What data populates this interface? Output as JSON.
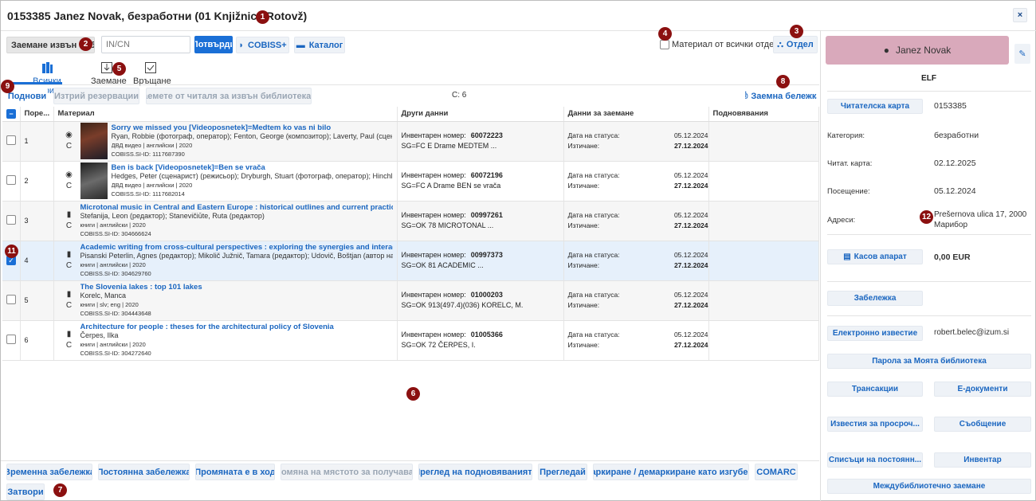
{
  "header": {
    "title": "0153385 Janez Novak, безработни (01 Knjižnica Rotovž)",
    "close": "×"
  },
  "badges": [
    "1",
    "2",
    "3",
    "4",
    "5",
    "6",
    "7",
    "8",
    "9",
    "11",
    "12"
  ],
  "toolbar": {
    "loan_outside": "Заемане извън биб",
    "input_placeholder": "IN/CN",
    "confirm": "Потвърди",
    "cobiss": "COBISS+",
    "catalog": "Каталог",
    "all_depts": "Материал от всички отдели",
    "dept": "Отдел"
  },
  "tabs": [
    {
      "label": "Всички материали"
    },
    {
      "label": "Заемане"
    },
    {
      "label": "Връщане"
    }
  ],
  "actions": {
    "renew": "Поднови",
    "delete_res": "Изтрий резервации",
    "loan_reading": "Заемете от читаля за извън библиотеката",
    "count": "С: 6",
    "loan_note": "Заемна бележка"
  },
  "table": {
    "headers": [
      "Поре...",
      "Материал",
      "Други данни",
      "Данни за заемане",
      "Подновявания"
    ],
    "rows": [
      {
        "no": "1",
        "icon": "video",
        "type": "C",
        "title": "Sorry we missed you [Videoposnetek]=Medtem ko vas ni bilo",
        "authors": "Ryan, Robbie (фотограф, оператор); Fenton, George (композитор); Laverty, Paul (сценарис",
        "pub": "ДВД видео | английски | 2020",
        "id": "COBISS.SI-ID: 1117687390",
        "inv_label": "Инвентарен номер:",
        "inv": "60072223",
        "sg": "SG=FC E Drame MEDTEM ...",
        "status_label": "Дата на статуса:",
        "status": "05.12.2024",
        "exp_label": "Изтичане:",
        "exp": "27.12.2024",
        "checked": false
      },
      {
        "no": "2",
        "icon": "video",
        "type": "C",
        "title": "Ben is back [Videoposnetek]=Ben se vrača",
        "authors": "Hedges, Peter (сценарист) (режисьор); Dryburgh, Stuart (фотограф, оператор); Hinchliffe, I",
        "pub": "ДВД видео | английски | 2020",
        "id": "COBISS.SI-ID: 1117682014",
        "inv_label": "Инвентарен номер:",
        "inv": "60072196",
        "sg": "SG=FC A Drame BEN se vrača",
        "status_label": "Дата на статуса:",
        "status": "05.12.2024",
        "exp_label": "Изтичане:",
        "exp": "27.12.2024",
        "checked": false
      },
      {
        "no": "3",
        "icon": "book",
        "type": "C",
        "title": "Microtonal music in Central and Eastern Europe : historical outlines and current practices",
        "authors": "Stefanija, Leon (редактор); Stanevičiūte, Ruta (редактор)",
        "pub": "книги | английски | 2020",
        "id": "COBISS.SI-ID: 304666624",
        "inv_label": "Инвентарен номер:",
        "inv": "00997261",
        "sg": "SG=OK 78 MICROTONAL ...",
        "status_label": "Дата на статуса:",
        "status": "05.12.2024",
        "exp_label": "Изтичане:",
        "exp": "27.12.2024",
        "checked": false
      },
      {
        "no": "4",
        "icon": "book",
        "type": "C",
        "title": "Academic writing from cross-cultural perspectives : exploring the synergies and interactions",
        "authors": "Pisanski Peterlin, Agnes (редактор); Mikolič Južnič, Tamara (редактор); Udovič, Boštjan (автор на реце",
        "pub": "книги | английски | 2020",
        "id": "COBISS.SI-ID: 304629760",
        "inv_label": "Инвентарен номер:",
        "inv": "00997373",
        "sg": "SG=OK 81 ACADEMIC ...",
        "status_label": "Дата на статуса:",
        "status": "05.12.2024",
        "exp_label": "Изтичане:",
        "exp": "27.12.2024",
        "checked": true
      },
      {
        "no": "5",
        "icon": "book",
        "type": "C",
        "title": "The Slovenia lakes : top 101 lakes",
        "authors": "Korelc, Manca",
        "pub": "книги | slv; eng | 2020",
        "id": "COBISS.SI-ID: 304443648",
        "inv_label": "Инвентарен номер:",
        "inv": "01000203",
        "sg": "SG=OK 913(497.4)(036) KORELC, M.",
        "status_label": "Дата на статуса:",
        "status": "05.12.2024",
        "exp_label": "Изтичане:",
        "exp": "27.12.2024",
        "checked": false
      },
      {
        "no": "6",
        "icon": "book",
        "type": "C",
        "title": "Architecture for people : theses for the architectural policy of Slovenia",
        "authors": "Čerpes, Ilka",
        "pub": "книги | английски | 2020",
        "id": "COBISS.SI-ID: 304272640",
        "inv_label": "Инвентарен номер:",
        "inv": "01005366",
        "sg": "SG=OK 72 ČERPES, I.",
        "status_label": "Дата на статуса:",
        "status": "05.12.2024",
        "exp_label": "Изтичане:",
        "exp": "27.12.2024",
        "checked": false
      }
    ]
  },
  "bottom": [
    "Временна забележка",
    "Постоянна забележка",
    "Промяната е в ход",
    "Промяна на мястото за получаване",
    "Преглед на подновяванията",
    "Прегледай",
    "Маркиране / демаркиране като изгубено",
    "COMARC"
  ],
  "close_btn": "Затвори",
  "patron": {
    "name": "Janez Novak",
    "code": "ELF",
    "card_btn": "Читателска карта",
    "card_no": "0153385",
    "cat_label": "Категория:",
    "cat": "безработни",
    "card_date_label": "Читат. карта:",
    "card_date": "02.12.2025",
    "visit_label": "Посещение:",
    "visit": "05.12.2024",
    "addr_label": "Адреси:",
    "addr1": "Prešernova ulica 17, 2000",
    "addr2": "Марибор",
    "cash_btn": "Касов апарат",
    "cash": "0,00 EUR",
    "note_btn": "Забележка",
    "email_btn": "Електронно известие",
    "email": "robert.belec@izum.si",
    "pass_btn": "Парола за Моята библиотека",
    "trans_btn": "Трансакции",
    "edoc_btn": "Е-документи",
    "overdue_btn": "Известия за просроч...",
    "msg_btn": "Съобщение",
    "lists_btn": "Списъци на постоянн...",
    "inventory_btn": "Инвентар",
    "ill_btn": "Междубиблиотечно заемане"
  },
  "colors": {
    "accent": "#1a6fd6",
    "badge": "#8b1010",
    "patron_bg": "#d9a9bb"
  }
}
